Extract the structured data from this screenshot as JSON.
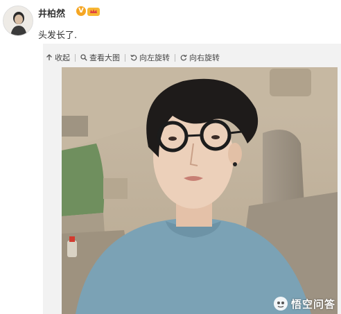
{
  "post": {
    "username": "井柏然",
    "verified_badge": "V",
    "text": "头发长了."
  },
  "toolbar": {
    "collapse_label": "收起",
    "view_large_label": "查看大图",
    "rotate_left_label": "向左旋转",
    "rotate_right_label": "向右旋转"
  },
  "watermark": {
    "text": "悟空问答"
  },
  "colors": {
    "card_background": "#f2f2f2",
    "verified_badge": "#f5a623",
    "username_text": "#333333"
  }
}
